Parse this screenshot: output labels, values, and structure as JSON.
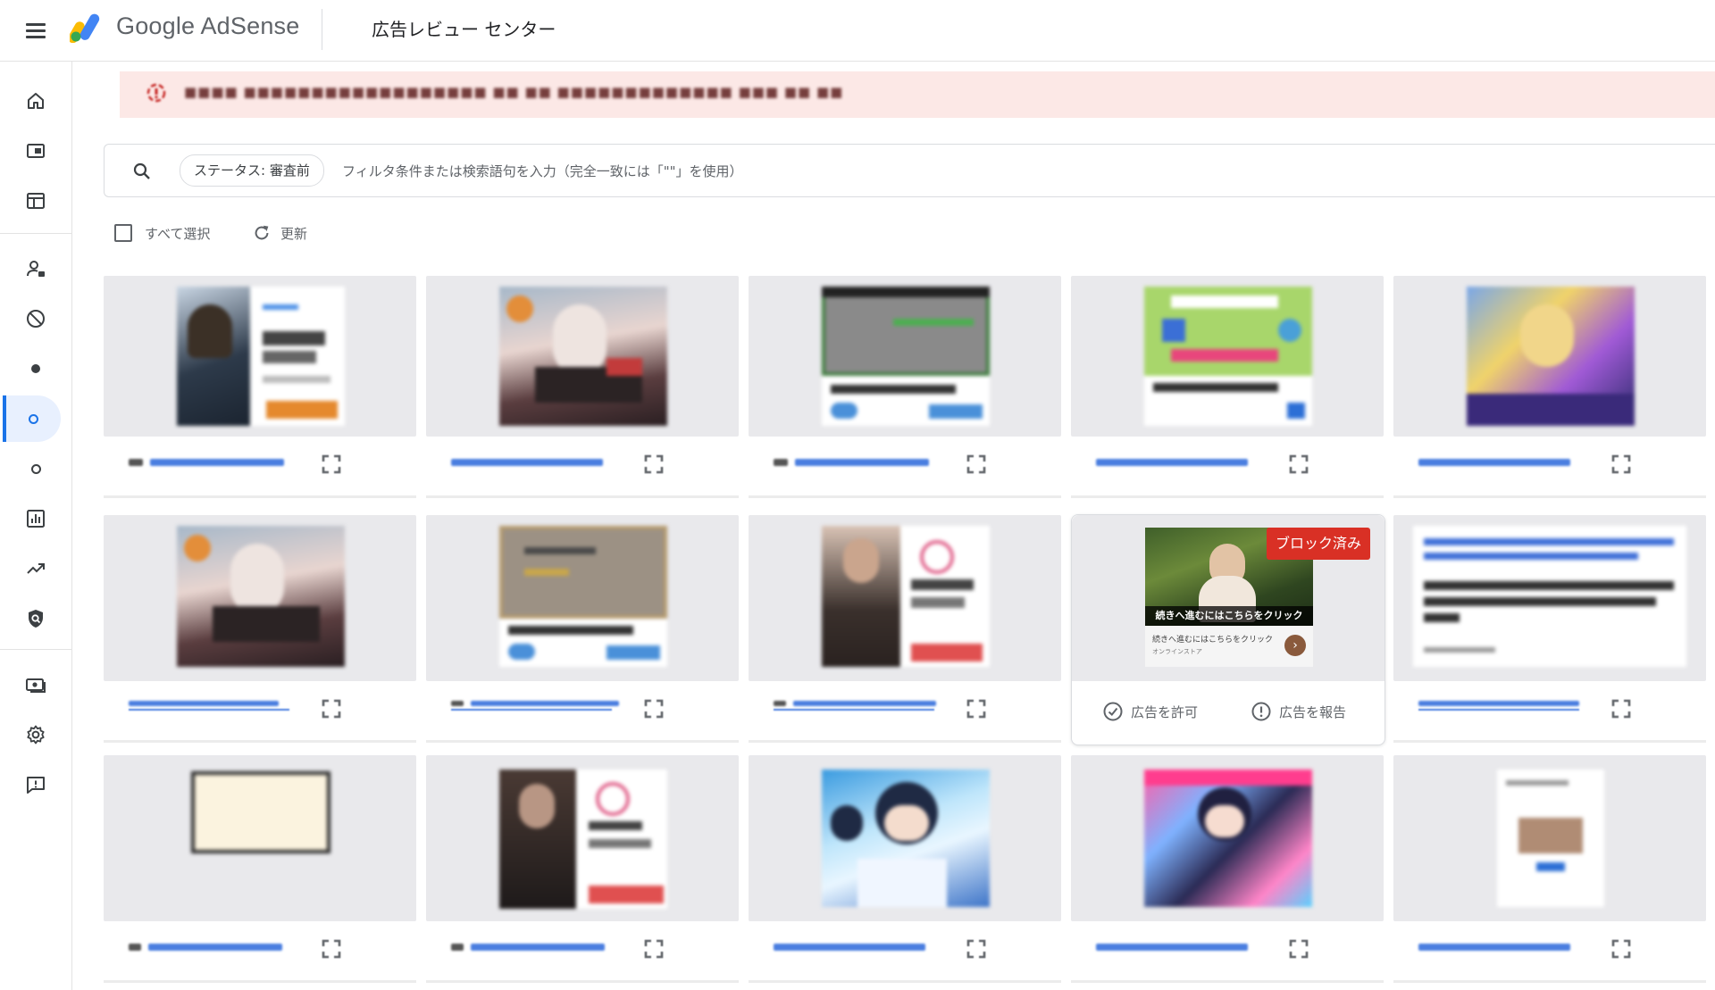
{
  "header": {
    "brand": "Google AdSense",
    "page_title": "広告レビュー センター"
  },
  "sidebar": {
    "items": [
      {
        "icon": "home-icon"
      },
      {
        "icon": "ads-icon"
      },
      {
        "icon": "sites-icon"
      },
      {
        "icon": "privacy-messaging-icon"
      },
      {
        "icon": "blocking-controls-icon"
      },
      {
        "icon": "dot-filled-icon"
      },
      {
        "icon": "dot-ring-icon",
        "active": true
      },
      {
        "icon": "dot-ring-icon"
      },
      {
        "icon": "reports-icon"
      },
      {
        "icon": "optimization-icon"
      },
      {
        "icon": "policy-center-icon"
      },
      {
        "icon": "payments-icon"
      },
      {
        "icon": "settings-icon"
      },
      {
        "icon": "feedback-icon"
      }
    ]
  },
  "alert": {
    "text": "■■■■ ■■■■■■■■■■■■■■■■■■ ■■ ■■ ■■■■■■■■■■■■■ ■■■ ■■ ■■",
    "color": "#fce8e6"
  },
  "filter": {
    "chip_label": "ステータス: 審査前",
    "placeholder": "フィルタ条件または検索語句を入力（完全一致には「\"\"」を使用）"
  },
  "toolbar": {
    "select_all": "すべて選択",
    "refresh": "更新"
  },
  "blocked_card": {
    "badge": "ブロック済み",
    "caption": "続きへ進むにはこちらをクリック",
    "sub_text": "続きへ進むにはこちらをクリック",
    "sub_small": "オンラインストア",
    "allow": "広告を許可",
    "report": "広告を報告"
  },
  "colors": {
    "accent": "#1a73e8",
    "badge_red": "#d93025",
    "card_bg": "#e9e9ec"
  }
}
